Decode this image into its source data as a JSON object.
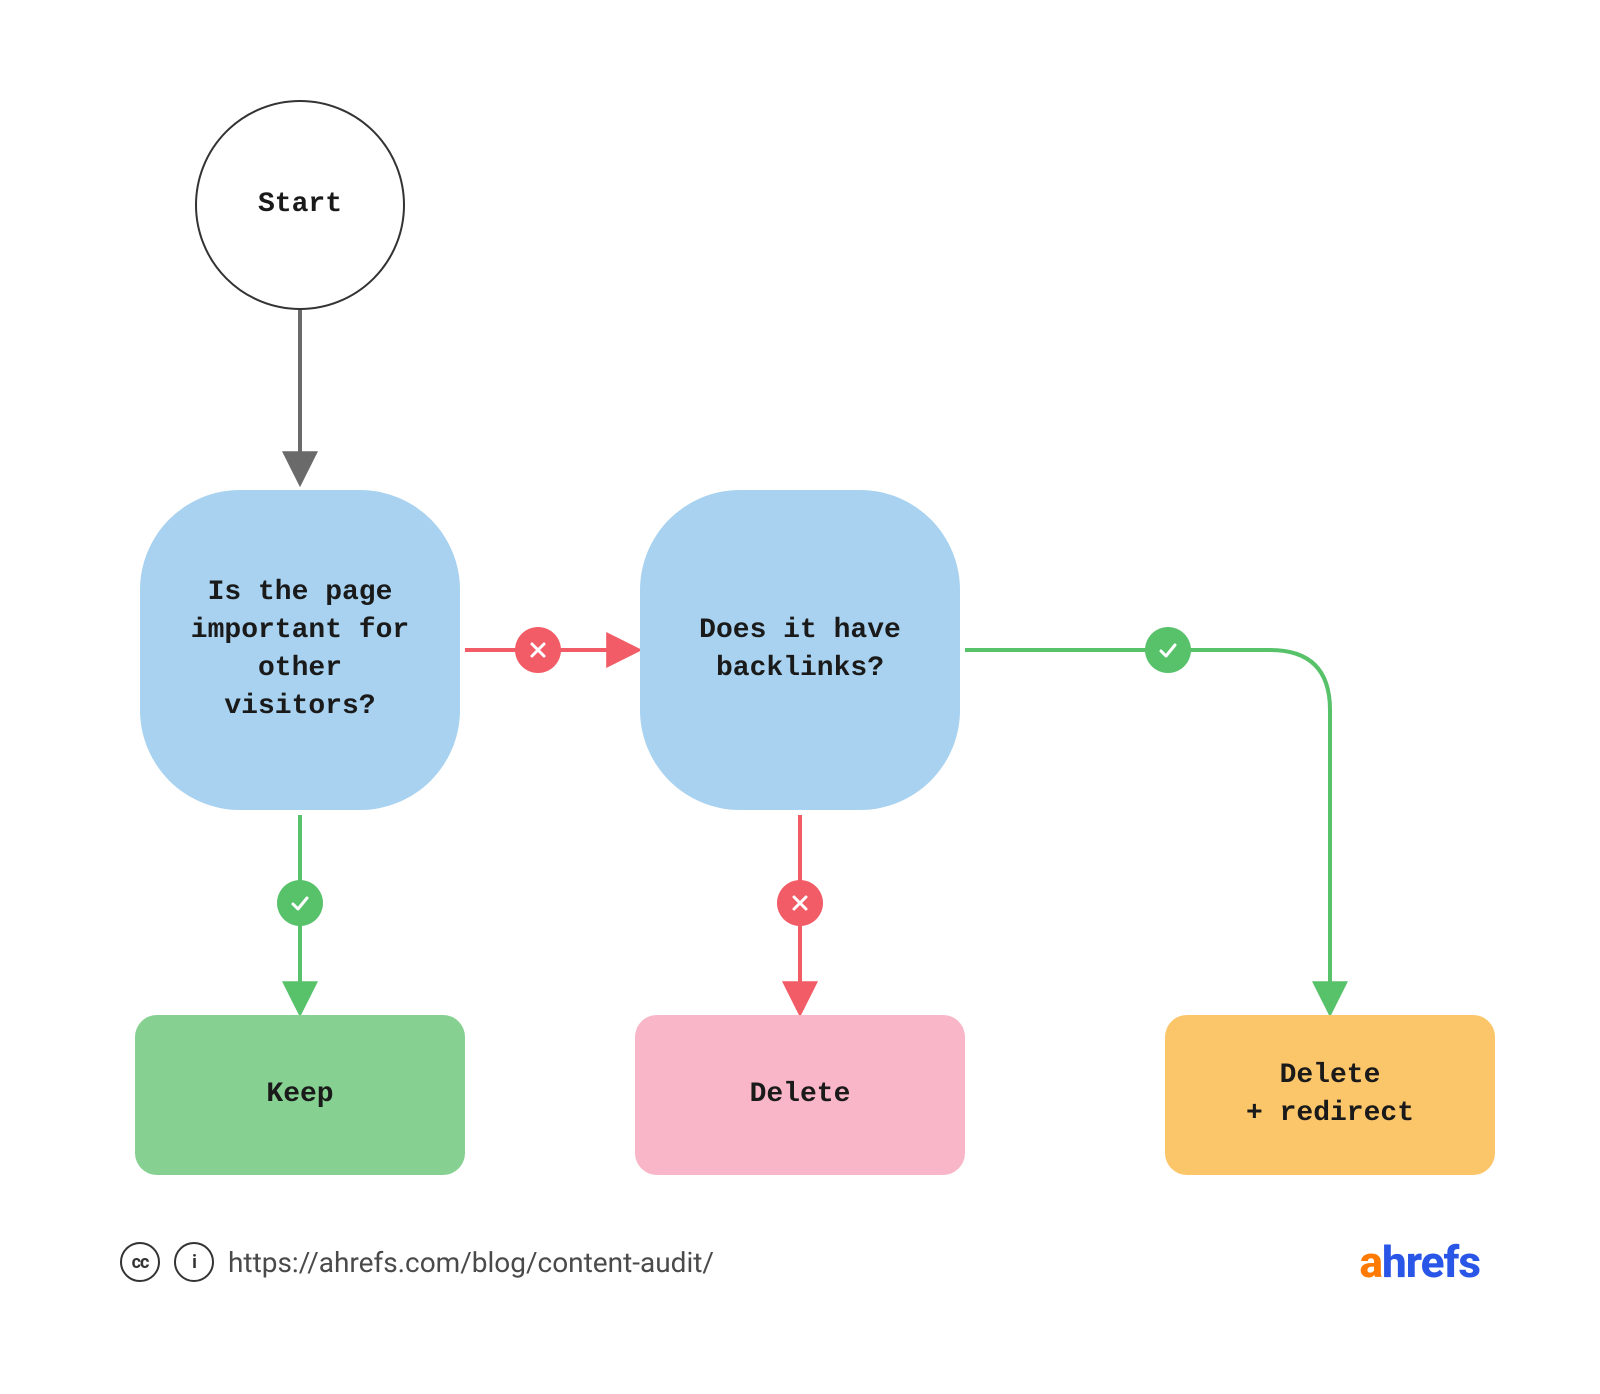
{
  "nodes": {
    "start": "Start",
    "decision1": "Is the page important for other visitors?",
    "decision2": "Does it have backlinks?",
    "action_keep": "Keep",
    "action_delete": "Delete",
    "action_delete_redirect": "Delete\n+ redirect"
  },
  "edges": {
    "start_to_d1": {
      "answer": null
    },
    "d1_yes_keep": {
      "answer": "yes"
    },
    "d1_no_d2": {
      "answer": "no"
    },
    "d2_no_delete": {
      "answer": "no"
    },
    "d2_yes_delr": {
      "answer": "yes"
    }
  },
  "colors": {
    "decision_fill": "#A8D2F0",
    "keep_fill": "#86D091",
    "delete_fill": "#F8B6C8",
    "delete_redirect_fill": "#FBC56A",
    "yes_edge": "#58C26B",
    "no_edge": "#F25C66",
    "neutral_edge": "#6A6A6A"
  },
  "footer": {
    "license_text_cc": "cc",
    "license_text_by": "i",
    "url": "https://ahrefs.com/blog/content-audit/",
    "brand_a": "a",
    "brand_rest": "hrefs"
  }
}
